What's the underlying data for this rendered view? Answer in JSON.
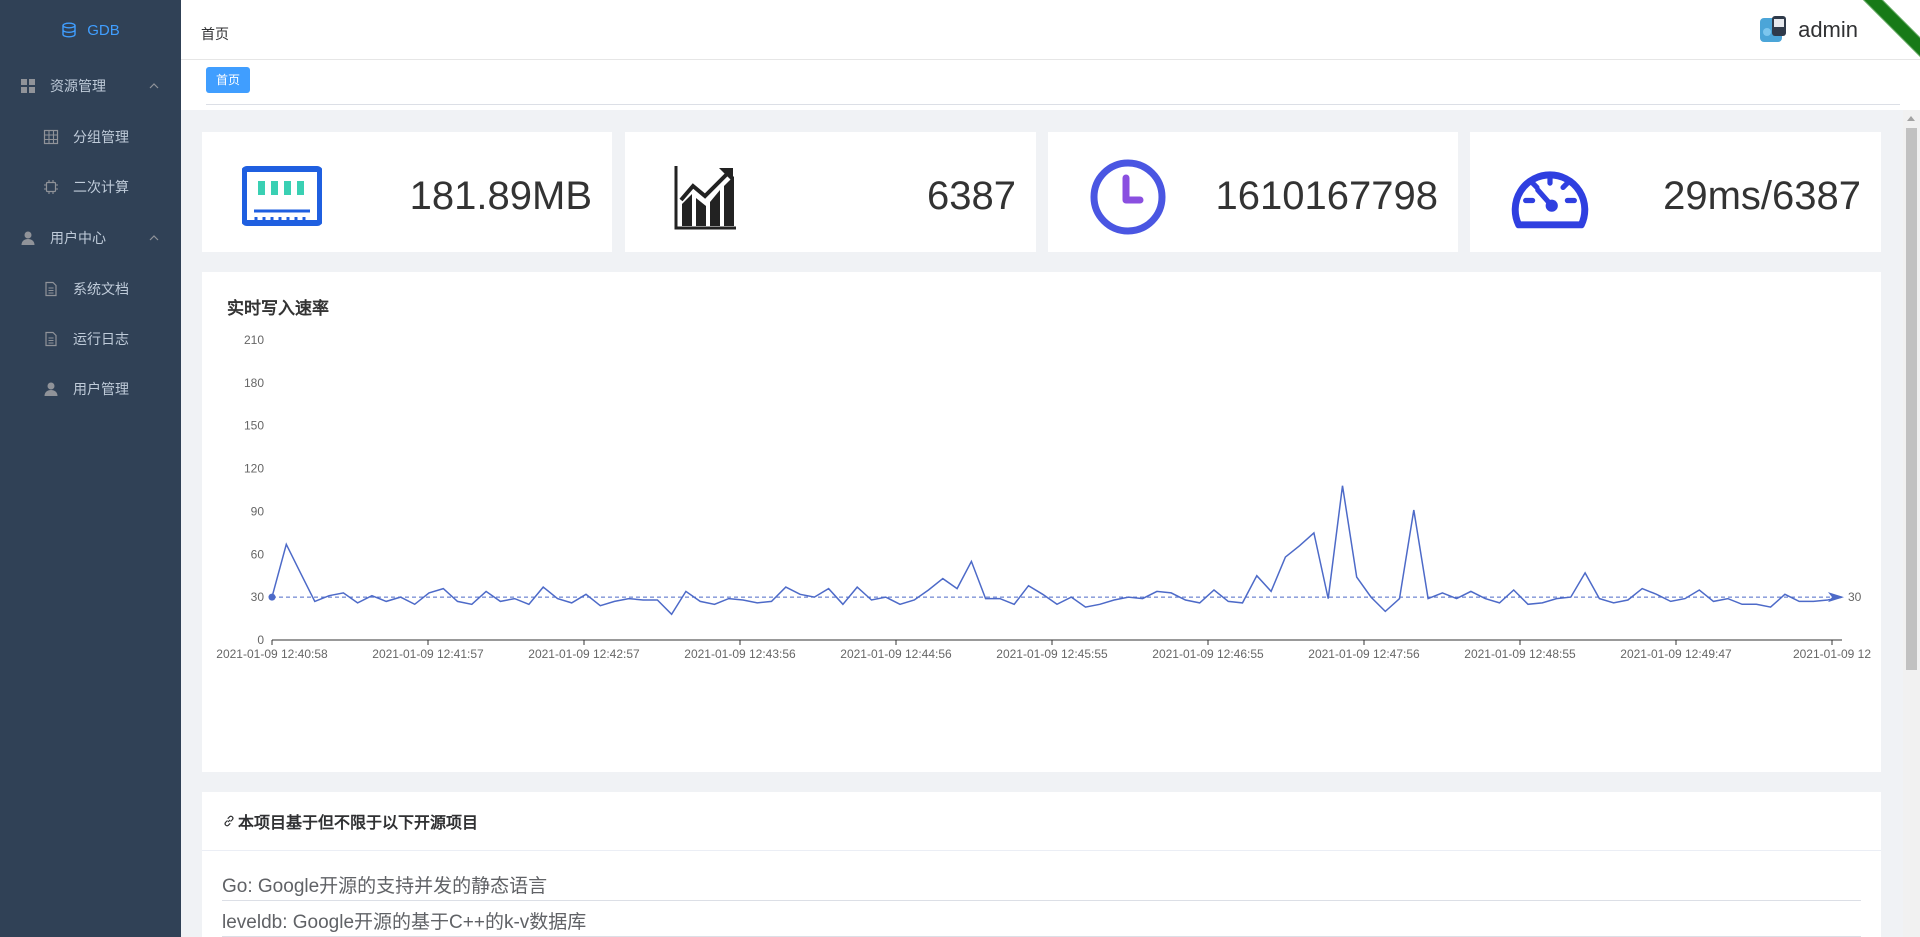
{
  "sidebar": {
    "logo": "GDB",
    "items": [
      {
        "label": "资源管理",
        "level": 1,
        "icon": "grid-icon"
      },
      {
        "label": "分组管理",
        "level": 2,
        "icon": "table-icon"
      },
      {
        "label": "二次计算",
        "level": 2,
        "icon": "chip-icon"
      },
      {
        "label": "用户中心",
        "level": 1,
        "icon": "user-icon"
      },
      {
        "label": "系统文档",
        "level": 2,
        "icon": "document-icon"
      },
      {
        "label": "运行日志",
        "level": 2,
        "icon": "document-icon"
      },
      {
        "label": "用户管理",
        "level": 2,
        "icon": "user-icon"
      }
    ]
  },
  "navbar": {
    "breadcrumb": "首页",
    "username": "admin"
  },
  "tags": {
    "active": "首页"
  },
  "stats": [
    {
      "icon": "memory-icon",
      "value": "181.89MB",
      "color": "#1f5fe0"
    },
    {
      "icon": "trend-chart-icon",
      "value": "6387",
      "color": "#222222"
    },
    {
      "icon": "clock-icon",
      "value": "1610167798",
      "color": "#4a56e2"
    },
    {
      "icon": "speedometer-icon",
      "value": "29ms/6387",
      "color": "#2f3fe0"
    }
  ],
  "chart_data": {
    "type": "line",
    "title": "实时写入速率",
    "ylim": [
      0,
      210
    ],
    "yticks": [
      0,
      30,
      60,
      90,
      120,
      150,
      180,
      210
    ],
    "xtick_labels": [
      "2021-01-09 12:40:58",
      "2021-01-09 12:41:57",
      "2021-01-09 12:42:57",
      "2021-01-09 12:43:56",
      "2021-01-09 12:44:56",
      "2021-01-09 12:45:55",
      "2021-01-09 12:46:55",
      "2021-01-09 12:47:56",
      "2021-01-09 12:48:55",
      "2021-01-09 12:49:47",
      "2021-01-09 12"
    ],
    "average_line": 30,
    "average_label": "30",
    "color": "#4d6ac8",
    "values": [
      30,
      67,
      47,
      27,
      31,
      33,
      26,
      31,
      27,
      30,
      25,
      33,
      36,
      27,
      25,
      34,
      27,
      29,
      25,
      37,
      29,
      26,
      32,
      24,
      27,
      29,
      28,
      28,
      18,
      34,
      27,
      25,
      29,
      28,
      26,
      27,
      37,
      32,
      30,
      36,
      25,
      37,
      28,
      30,
      25,
      28,
      35,
      43,
      36,
      55,
      29,
      29,
      25,
      38,
      32,
      25,
      30,
      23,
      25,
      28,
      30,
      29,
      34,
      33,
      28,
      26,
      35,
      27,
      26,
      45,
      34,
      58,
      66,
      75,
      29,
      108,
      44,
      30,
      20,
      29,
      91,
      29,
      33,
      29,
      34,
      29,
      26,
      35,
      25,
      26,
      29,
      30,
      47,
      29,
      26,
      28,
      36,
      32,
      27,
      29,
      35,
      27,
      29,
      25,
      25,
      23,
      32,
      27,
      27,
      28,
      30
    ]
  },
  "projects": {
    "header": "本项目基于但不限于以下开源项目",
    "items": [
      "Go: Google开源的支持并发的静态语言",
      "leveldb: Google开源的基于C++的k-v数据库"
    ]
  }
}
